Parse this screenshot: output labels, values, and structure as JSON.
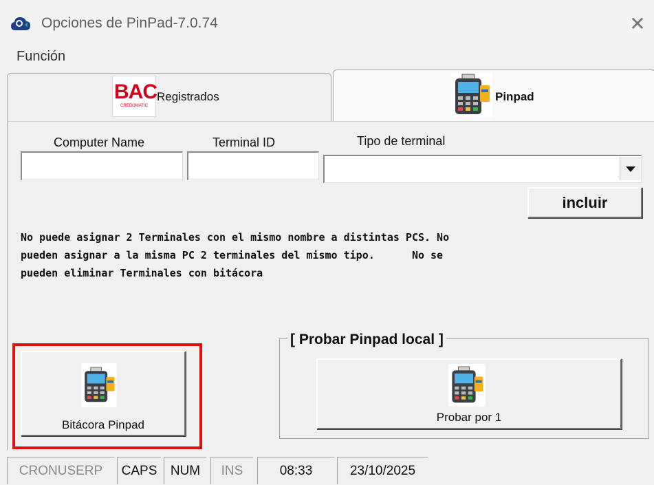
{
  "window": {
    "title": "Opciones de PinPad-7.0.74",
    "close_icon": "close-icon"
  },
  "menu": {
    "items": [
      {
        "label": "Función"
      }
    ]
  },
  "tabs": [
    {
      "label": "Registrados",
      "icon": "bac-credomatic-logo",
      "logo_text": "BAC",
      "logo_subtext": "CREDOMATIC",
      "active": false
    },
    {
      "label": "Pinpad",
      "icon": "pinpad-terminal-icon",
      "active": true
    }
  ],
  "form": {
    "computer_name": {
      "label": "Computer Name",
      "value": ""
    },
    "terminal_id": {
      "label": "Terminal ID",
      "value": ""
    },
    "terminal_type": {
      "label": "Tipo de terminal",
      "value": ""
    },
    "add_button": "incluir"
  },
  "notice": "No puede asignar 2 Terminales con el mismo nombre a distintas PCS. No\npueden asignar a la misma PC 2 terminales del mismo tipo.      No se\npueden eliminar Terminales con bitácora",
  "log_button": {
    "label": "Bitácora Pinpad",
    "icon": "pinpad-terminal-icon"
  },
  "local_test": {
    "title": "[ Probar Pinpad local ]",
    "button_label": "Probar por 1",
    "icon": "pinpad-terminal-icon"
  },
  "status": {
    "user": "CRONUSERP",
    "caps": "CAPS",
    "num": "NUM",
    "ins": "INS",
    "time": "08:33",
    "date": "23/10/2025"
  },
  "colors": {
    "highlight": "#e01010",
    "bac_red": "#d0021b",
    "pinpad_screen": "#4fb3e8",
    "card": "#f2b01e"
  }
}
